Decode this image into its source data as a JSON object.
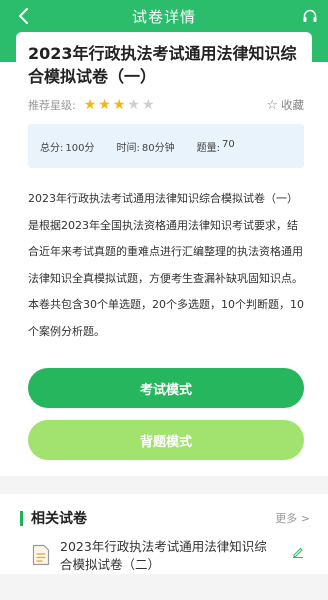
{
  "nav": {
    "title": "试卷详情",
    "back_icon": "back-chevron-icon",
    "right_icon": "headset-icon"
  },
  "paper": {
    "title": "2023年行政执法考试通用法律知识综合模拟试卷（一）",
    "rating_label": "推荐星级:",
    "rating": 3,
    "rating_max": 5,
    "collect_label": "收藏",
    "info": {
      "total_label": "总分:",
      "total_value": "100分",
      "time_label": "时间:",
      "time_value": "80分钟",
      "count_label": "题量:",
      "count_value": "70"
    },
    "description": "2023年行政执法考试通用法律知识综合模拟试卷（一）是根据2023年全国执法资格通用法律知识考试要求，结合近年来考试真题的重难点进行汇编整理的执法资格通用法律知识全真模拟试题，方便考生查漏补缺巩固知识点。本卷共包含30个单选题，20个多选题，10个判断题，10个案例分析题。"
  },
  "buttons": {
    "exam_mode": "考试模式",
    "memorize_mode": "背题模式"
  },
  "related": {
    "title": "相关试卷",
    "more": "更多 >",
    "items": [
      {
        "title": "2023年行政执法考试通用法律知识综合模拟试卷（二）"
      }
    ]
  },
  "colors": {
    "primary": "#2bbd6b",
    "exam_button": "#26b65d",
    "memorize_button": "#a2e26f",
    "star_on": "#f7b21c",
    "info_bg": "#e9f3fb"
  }
}
